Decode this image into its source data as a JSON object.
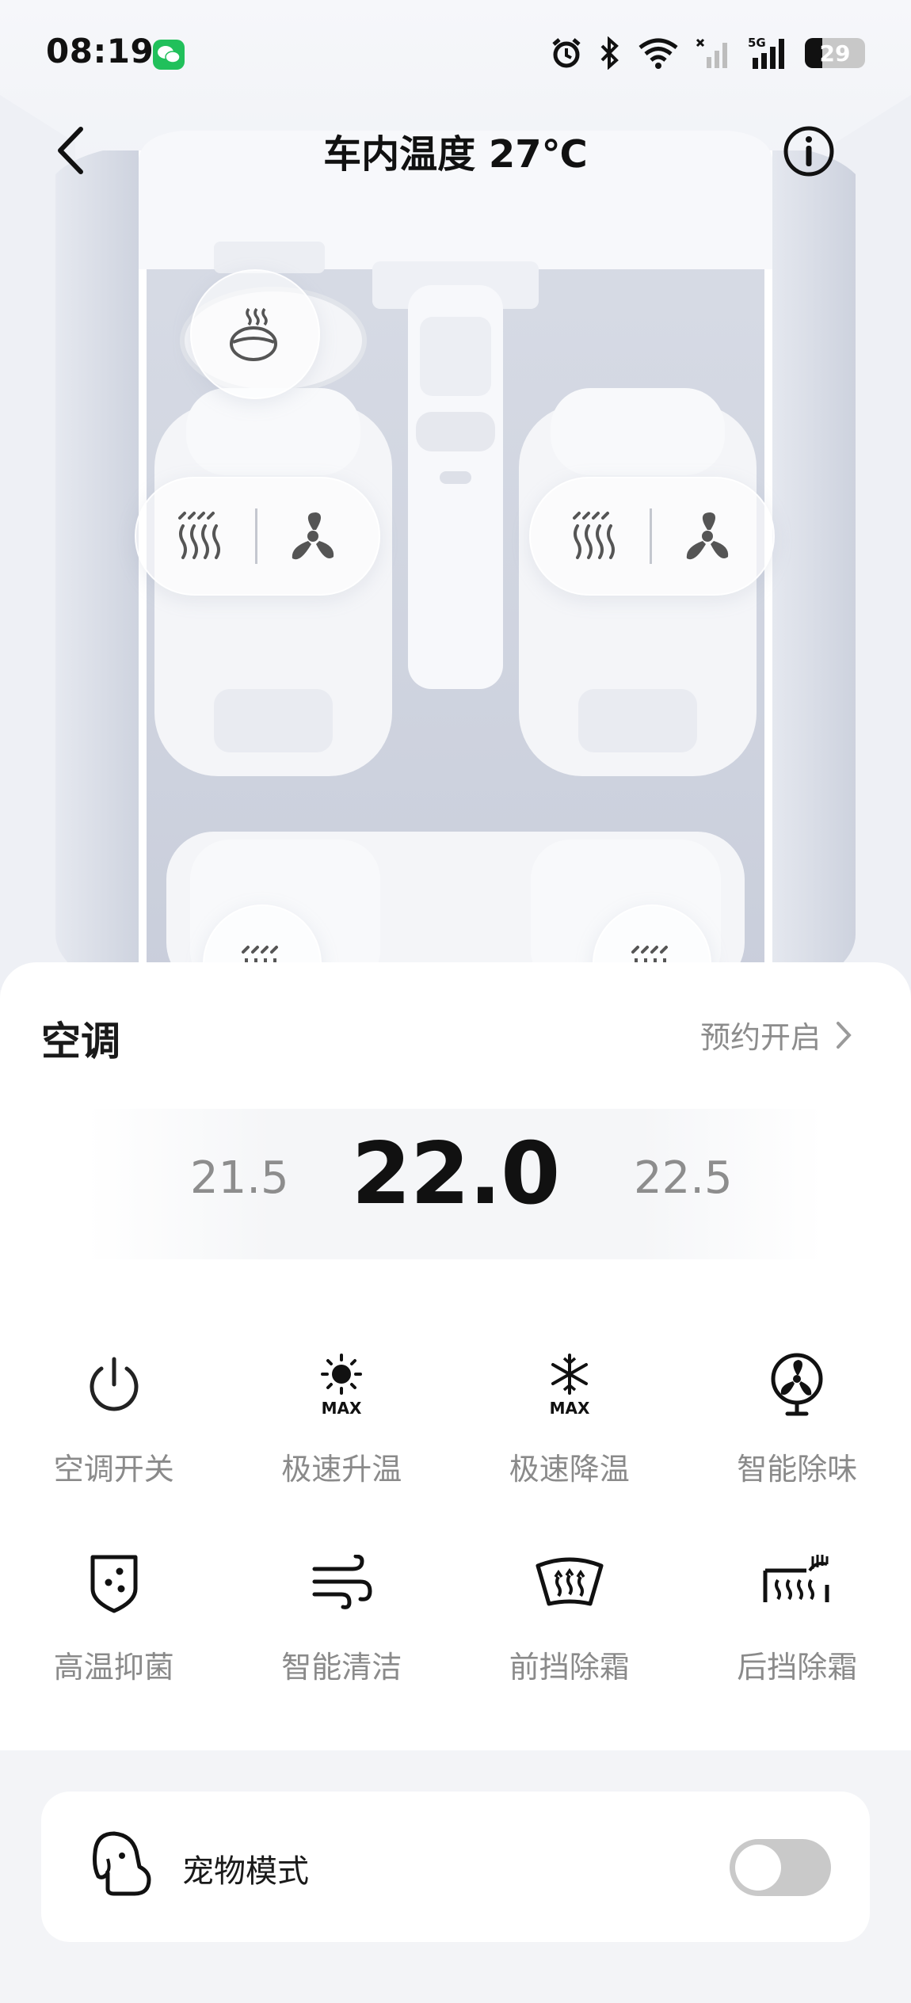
{
  "status_bar": {
    "time": "08:19",
    "battery_level": "29",
    "icons": [
      "wechat-icon",
      "alarm-icon",
      "bluetooth-icon",
      "wifi-icon",
      "signal-icon",
      "signal-5g-icon",
      "battery-icon"
    ]
  },
  "header": {
    "title": "车内温度 27℃",
    "back_icon": "chevron-left-icon",
    "info_icon": "info-icon"
  },
  "seats": {
    "steering_heat_icon": "steering-wheel-heat-icon",
    "driver": {
      "heat_icon": "seat-heat-icon",
      "vent_icon": "seat-fan-icon"
    },
    "passenger": {
      "heat_icon": "seat-heat-icon",
      "vent_icon": "seat-fan-icon"
    },
    "rear_left": {
      "heat_icon": "seat-heat-icon"
    },
    "rear_right": {
      "heat_icon": "seat-heat-icon"
    }
  },
  "ac": {
    "title": "空调",
    "schedule_label": "预约开启",
    "temperature": {
      "prev": "21.5",
      "current": "22.0",
      "next": "22.5"
    },
    "controls": [
      {
        "label": "空调开关",
        "icon": "power-icon"
      },
      {
        "label": "极速升温",
        "icon": "sun-max-icon"
      },
      {
        "label": "极速降温",
        "icon": "snowflake-max-icon"
      },
      {
        "label": "智能除味",
        "icon": "fan-icon"
      },
      {
        "label": "高温抑菌",
        "icon": "shield-dots-icon"
      },
      {
        "label": "智能清洁",
        "icon": "wind-icon"
      },
      {
        "label": "前挡除霜",
        "icon": "front-defrost-icon"
      },
      {
        "label": "后挡除霜",
        "icon": "rear-defrost-icon"
      }
    ]
  },
  "pet_mode": {
    "label": "宠物模式",
    "enabled": false,
    "icon": "dog-icon"
  },
  "colors": {
    "accent_green": "#21c05b",
    "text_primary": "#111111",
    "text_secondary": "#8a8a8a"
  }
}
